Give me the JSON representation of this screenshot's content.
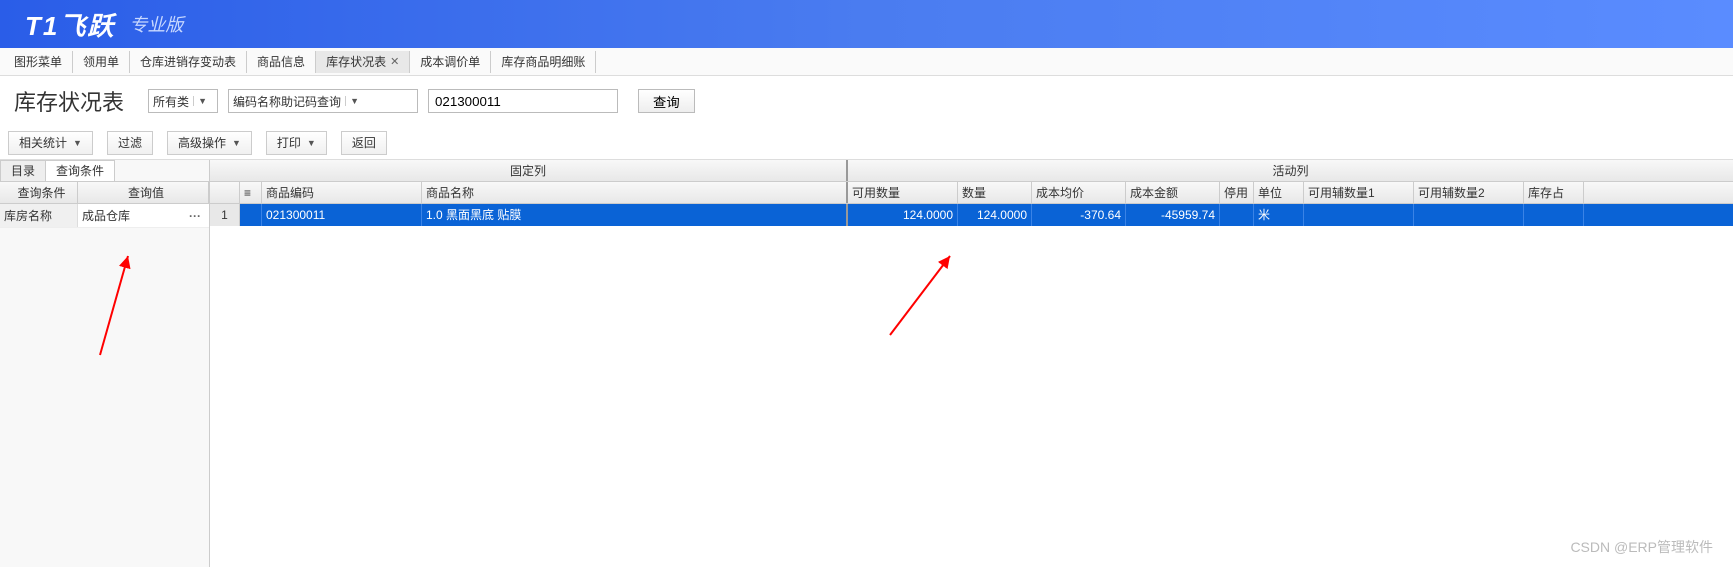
{
  "header": {
    "logo": "T1飞跃",
    "edition": "专业版"
  },
  "tabs": [
    {
      "label": "图形菜单",
      "active": false,
      "closable": false
    },
    {
      "label": "领用单",
      "active": false,
      "closable": false
    },
    {
      "label": "仓库进销存变动表",
      "active": false,
      "closable": false
    },
    {
      "label": "商品信息",
      "active": false,
      "closable": false
    },
    {
      "label": "库存状况表",
      "active": true,
      "closable": true
    },
    {
      "label": "成本调价单",
      "active": false,
      "closable": false
    },
    {
      "label": "库存商品明细账",
      "active": false,
      "closable": false
    }
  ],
  "title_bar": {
    "title": "库存状况表",
    "category_selected": "所有类",
    "search_field_label": "编码名称助记码查询",
    "search_value": "021300011",
    "query_btn": "查询"
  },
  "toolbar": {
    "stats": "相关统计",
    "filter": "过滤",
    "advanced": "高级操作",
    "print": "打印",
    "back": "返回"
  },
  "sidebar": {
    "tabs": {
      "catalog": "目录",
      "query_cond": "查询条件"
    },
    "headers": {
      "cond": "查询条件",
      "val": "查询值"
    },
    "row": {
      "label": "库房名称",
      "value": "成品仓库"
    }
  },
  "grid": {
    "group_fixed": "固定列",
    "group_active": "活动列",
    "headers": {
      "code": "商品编码",
      "name": "商品名称",
      "avail": "可用数量",
      "qty": "数量",
      "avgcost": "成本均价",
      "costamt": "成本金额",
      "stop": "停用",
      "unit": "单位",
      "aux1": "可用辅数量1",
      "aux2": "可用辅数量2",
      "stock": "库存占"
    },
    "row": {
      "num": "1",
      "code": "021300011",
      "name": "1.0 黑面黑底 贴膜",
      "avail": "124.0000",
      "qty": "124.0000",
      "avgcost": "-370.64",
      "costamt": "-45959.74",
      "unit": "米",
      "aux1": "",
      "aux2": "",
      "stock": ""
    }
  },
  "watermark": "CSDN @ERP管理软件"
}
